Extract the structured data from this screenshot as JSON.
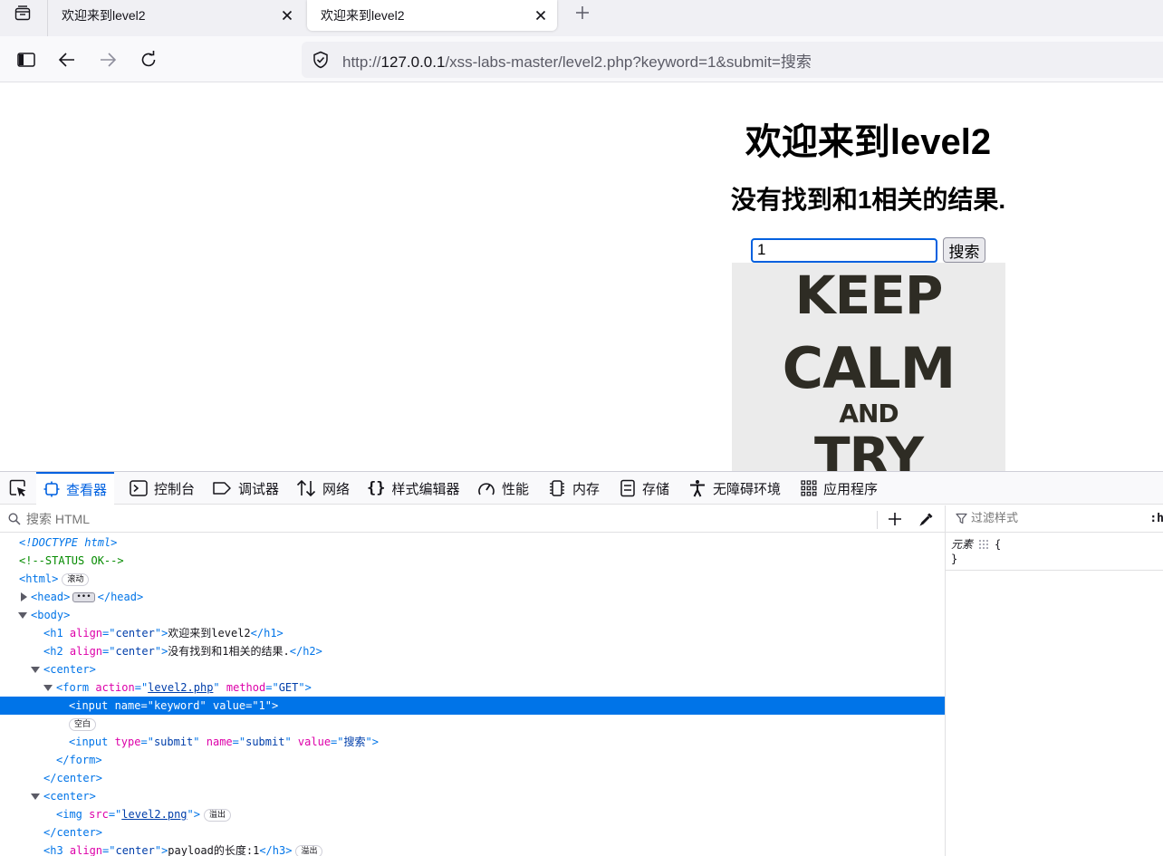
{
  "browser": {
    "tabs": [
      {
        "title": "欢迎来到level2",
        "active": false
      },
      {
        "title": "欢迎来到level2",
        "active": true
      }
    ],
    "url": {
      "scheme": "http://",
      "host": "127.0.0.1",
      "path": "/xss-labs-master/level2.php?keyword=1&submit=搜索"
    },
    "icons": {
      "tab_manager": "tab-manager-icon",
      "close": "close-icon",
      "new_tab": "plus-icon",
      "sidebar": "sidebar-icon",
      "back": "back-arrow-icon",
      "forward": "forward-arrow-icon",
      "reload": "reload-icon",
      "shield": "shield-icon"
    }
  },
  "page": {
    "h1": "欢迎来到level2",
    "h2": "没有找到和1相关的结果.",
    "keyword_value": "1",
    "submit_label": "搜索",
    "poster": {
      "line1": "KEEP",
      "line2": "CALM",
      "line3": "AND",
      "line4": "TRY"
    }
  },
  "devtools": {
    "tabs": [
      {
        "label": "查看器",
        "icon": "inspector-icon",
        "active": true
      },
      {
        "label": "控制台",
        "icon": "console-icon"
      },
      {
        "label": "调试器",
        "icon": "debugger-icon"
      },
      {
        "label": "网络",
        "icon": "network-icon"
      },
      {
        "label": "样式编辑器",
        "icon": "style-editor-icon"
      },
      {
        "label": "性能",
        "icon": "performance-icon"
      },
      {
        "label": "内存",
        "icon": "memory-icon"
      },
      {
        "label": "存储",
        "icon": "storage-icon"
      },
      {
        "label": "无障碍环境",
        "icon": "accessibility-icon"
      },
      {
        "label": "应用程序",
        "icon": "application-icon"
      }
    ],
    "search_placeholder": "搜索 HTML",
    "filter_placeholder": "过滤样式",
    "hov_label": ":h",
    "rule_selector": "元素",
    "rule_open": "{",
    "rule_close": "}",
    "badges": {
      "scroll": "滚动",
      "whitespace": "空白",
      "overflow": "溢出"
    },
    "markup": {
      "doctype": "<!DOCTYPE html>",
      "comment": "<!--STATUS OK-->",
      "h1_text": "欢迎来到level2",
      "h2_text": "没有找到和1相关的结果.",
      "form_action": "level2.php",
      "form_method": "GET",
      "input_name": "keyword",
      "input_value": "1",
      "submit_type": "submit",
      "submit_name": "submit",
      "submit_value": "搜索",
      "img_src": "level2.png",
      "h3_text": "payload的长度:1",
      "align_value": "center"
    },
    "accent_color": "#0074e8"
  }
}
